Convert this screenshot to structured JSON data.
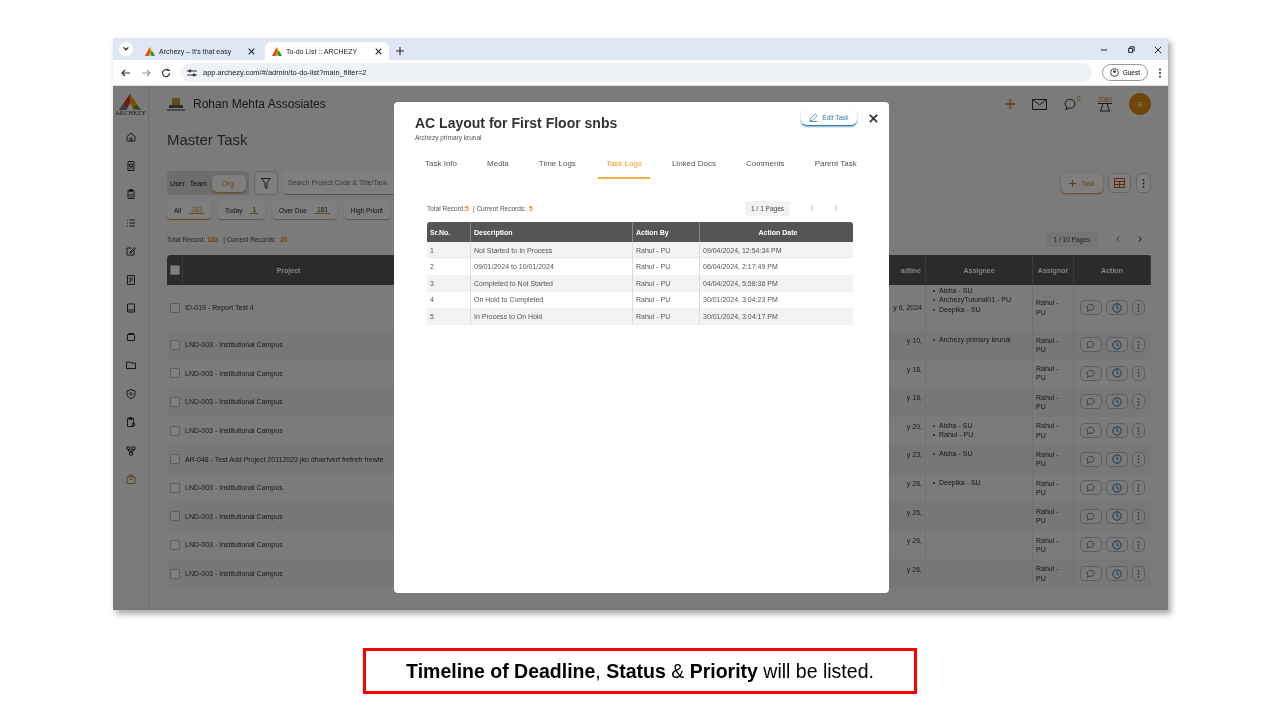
{
  "browser": {
    "tabs": [
      {
        "title": "Archezy – It's that easy",
        "selected": false
      },
      {
        "title": "To-do List :: ARCHEZY",
        "selected": true
      }
    ],
    "url": "app.archezy.com/#/admin/to-do-list?main_filter=2",
    "profile": "Guest"
  },
  "app": {
    "logo_text": "ARCHEZY",
    "company": "Rohan Mehta Assosiates",
    "messages_count": "0",
    "alerts_count": "2080",
    "avatar": "R",
    "page_title": "Master Task",
    "view_toggle": [
      {
        "label": "User",
        "selected": false
      },
      {
        "label": "Team",
        "selected": false
      },
      {
        "label": "Org.",
        "selected": true
      }
    ],
    "search": {
      "placeholder": "Search Project Code & Title/Task"
    },
    "add_button": "Task",
    "filters": [
      {
        "label": "All",
        "count": "183",
        "selected": true
      },
      {
        "label": "Today",
        "count": "1",
        "selected": false
      },
      {
        "label": "Over Due",
        "count": "181",
        "selected": false
      },
      {
        "label": "High Priorit",
        "selected": false
      }
    ],
    "summary": {
      "total_label": "Total Record:",
      "total": "183",
      "current_label": "| Current Records:",
      "current": "20"
    },
    "pager": "1 / 10 Pages",
    "table": {
      "columns": [
        "Project",
        "adline",
        "Assignee",
        "Assignor",
        "Action"
      ],
      "select_all_checked": false,
      "rows": [
        {
          "checked": false,
          "project": "ID-019 - Report Test 4",
          "deadline": "y 6, 2024",
          "assignees": [
            "Aisha - SU",
            "ArchezyTutorial01 - PU",
            "Deepika - SU"
          ],
          "assignor": "Rahul - PU"
        },
        {
          "checked": false,
          "project": "LND-003 - Institutional Campus",
          "deadline": "y 10,",
          "assignees": [
            "Archezy primary krunal"
          ],
          "assignor": "Rahul - PU"
        },
        {
          "checked": false,
          "project": "LND-003 - Institutional Campus",
          "deadline": "y 18,",
          "assignor": "Rahul - PU"
        },
        {
          "checked": false,
          "project": "LND-003 - Institutional Campus",
          "deadline": "y 18,",
          "assignor": "Rahul - PU"
        },
        {
          "checked": false,
          "project": "LND-003 - Institutional Campus",
          "deadline": "y 20,",
          "assignees": [
            "Aisha - SU",
            "Rahul - PU"
          ],
          "assignor": "Rahul - PU"
        },
        {
          "checked": false,
          "project": "AR-048 - Test Add Project 20112023 jkn dfverfverf frefrefr frewfe",
          "deadline": "y 23,",
          "assignees": [
            "Aisha - SU"
          ],
          "assignor": "Rahul - PU"
        },
        {
          "checked": false,
          "project": "LND-003 - Institutional Campus",
          "deadline": "y 26,",
          "assignees": [
            "Deepika - SU"
          ],
          "assignor": "Rahul - PU"
        },
        {
          "checked": false,
          "project": "LND-003 - Institutional Campus",
          "deadline": "y 26,",
          "assignor": "Rahul - PU"
        },
        {
          "checked": false,
          "project": "LND-003 - Institutional Campus",
          "deadline": "y 26,",
          "assignor": "Rahul - PU"
        },
        {
          "checked": false,
          "project": "LND-003 - Institutional Campus",
          "deadline": "y 26,",
          "assignor": "Rahul - PU"
        }
      ]
    }
  },
  "modal": {
    "title": "AC Layout for First Floor snbs",
    "subtitle": "Archezy primary krunal",
    "edit_button": "Edit Task",
    "tabs": [
      {
        "label": "Task Info",
        "selected": false
      },
      {
        "label": "Media",
        "selected": false
      },
      {
        "label": "Time Logs",
        "selected": false
      },
      {
        "label": "Task Logs",
        "selected": true
      },
      {
        "label": "Linked Docs",
        "selected": false
      },
      {
        "label": "Comments",
        "selected": false
      },
      {
        "label": "Parent Task",
        "selected": false
      }
    ],
    "summary": {
      "total_label": "Total Record:",
      "total": "5",
      "current_label": "| Current Records:",
      "current": "5"
    },
    "pager": "1 / 1 Pages",
    "table": {
      "columns": [
        "Sr.No.",
        "Description",
        "Action By",
        "Action Date"
      ],
      "rows": [
        [
          "1",
          "Not Started to In Process",
          "Rahul - PU",
          "09/04/2024, 12:54:34 PM"
        ],
        [
          "2",
          "09/01/2024 to 10/01/2024",
          "Rahul - PU",
          "06/04/2024, 2:17:49 PM"
        ],
        [
          "3",
          "Completed to Not Started",
          "Rahul - PU",
          "04/04/2024, 5:58:36 PM"
        ],
        [
          "4",
          "On Hold to Completed",
          "Rahul - PU",
          "30/01/2024, 3:04:23 PM"
        ],
        [
          "5",
          "In Process to On Hold",
          "Rahul - PU",
          "30/01/2024, 3:04:17 PM"
        ]
      ]
    }
  },
  "caption": "**Timeline of Deadline**, **Status** & **Priority** will be listed."
}
